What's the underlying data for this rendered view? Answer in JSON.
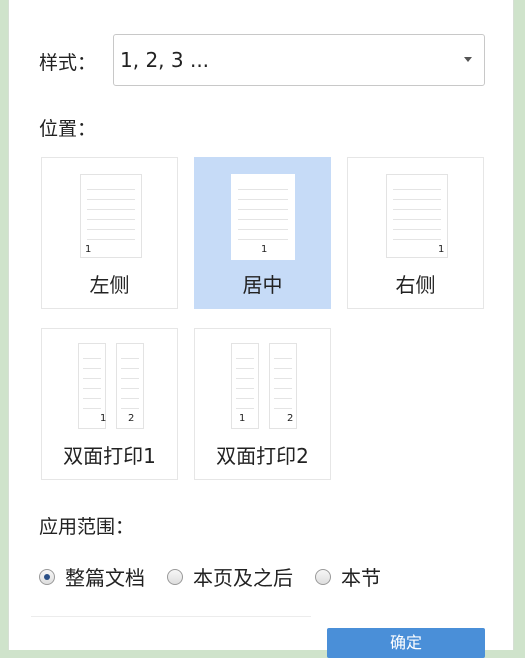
{
  "style_row": {
    "label": "样式：",
    "selected": "1, 2, 3 ..."
  },
  "position": {
    "label": "位置：",
    "options": [
      {
        "label": "左侧",
        "numbers": [
          "1"
        ]
      },
      {
        "label": "居中",
        "numbers": [
          "1"
        ]
      },
      {
        "label": "右侧",
        "numbers": [
          "1"
        ]
      },
      {
        "label": "双面打印1",
        "numbers": [
          "1",
          "2"
        ]
      },
      {
        "label": "双面打印2",
        "numbers": [
          "1",
          "2"
        ]
      }
    ],
    "selected_index": 1
  },
  "apply_range": {
    "label": "应用范围：",
    "options": [
      "整篇文档",
      "本页及之后",
      "本节"
    ],
    "selected_index": 0
  },
  "confirm_button": {
    "label": "确定"
  },
  "colors": {
    "selected_tile": "#c6dbf7",
    "button": "#4a8fd8"
  }
}
